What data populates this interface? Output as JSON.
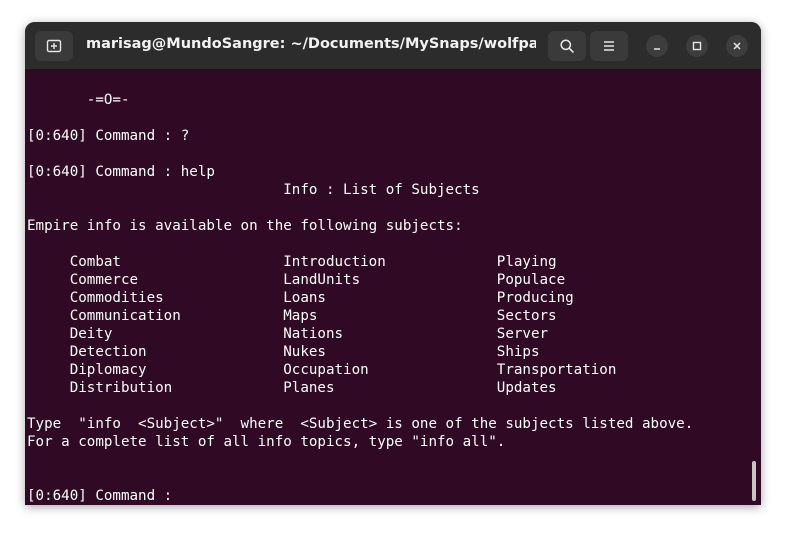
{
  "window": {
    "title": "marisag@MundoSangre: ~/Documents/MySnaps/wolfpack-e..."
  },
  "terminal": {
    "lines": [
      {
        "row": 0,
        "text": "       -=O=-"
      },
      {
        "row": 2,
        "text": "[0:640] Command : ?"
      },
      {
        "row": 4,
        "text": "[0:640] Command : help"
      },
      {
        "row": 5,
        "text": "                              Info : List of Subjects"
      },
      {
        "row": 7,
        "text": "Empire info is available on the following subjects:"
      },
      {
        "row": 9,
        "text": "     Combat                   Introduction             Playing"
      },
      {
        "row": 10,
        "text": "     Commerce                 LandUnits                Populace"
      },
      {
        "row": 11,
        "text": "     Commodities              Loans                    Producing"
      },
      {
        "row": 12,
        "text": "     Communication            Maps                     Sectors"
      },
      {
        "row": 13,
        "text": "     Deity                    Nations                  Server"
      },
      {
        "row": 14,
        "text": "     Detection                Nukes                    Ships"
      },
      {
        "row": 15,
        "text": "     Diplomacy                Occupation               Transportation"
      },
      {
        "row": 16,
        "text": "     Distribution             Planes                   Updates"
      },
      {
        "row": 18,
        "text": "Type  \"info  <Subject>\"  where  <Subject> is one of the subjects listed above."
      },
      {
        "row": 19,
        "text": "For a complete list of all info topics, type \"info all\"."
      },
      {
        "row": 22,
        "text": "[0:640] Command : "
      }
    ]
  },
  "colors": {
    "terminal_bg": "#300a24",
    "titlebar_bg": "#2c2c2c",
    "text": "#ffffff"
  }
}
